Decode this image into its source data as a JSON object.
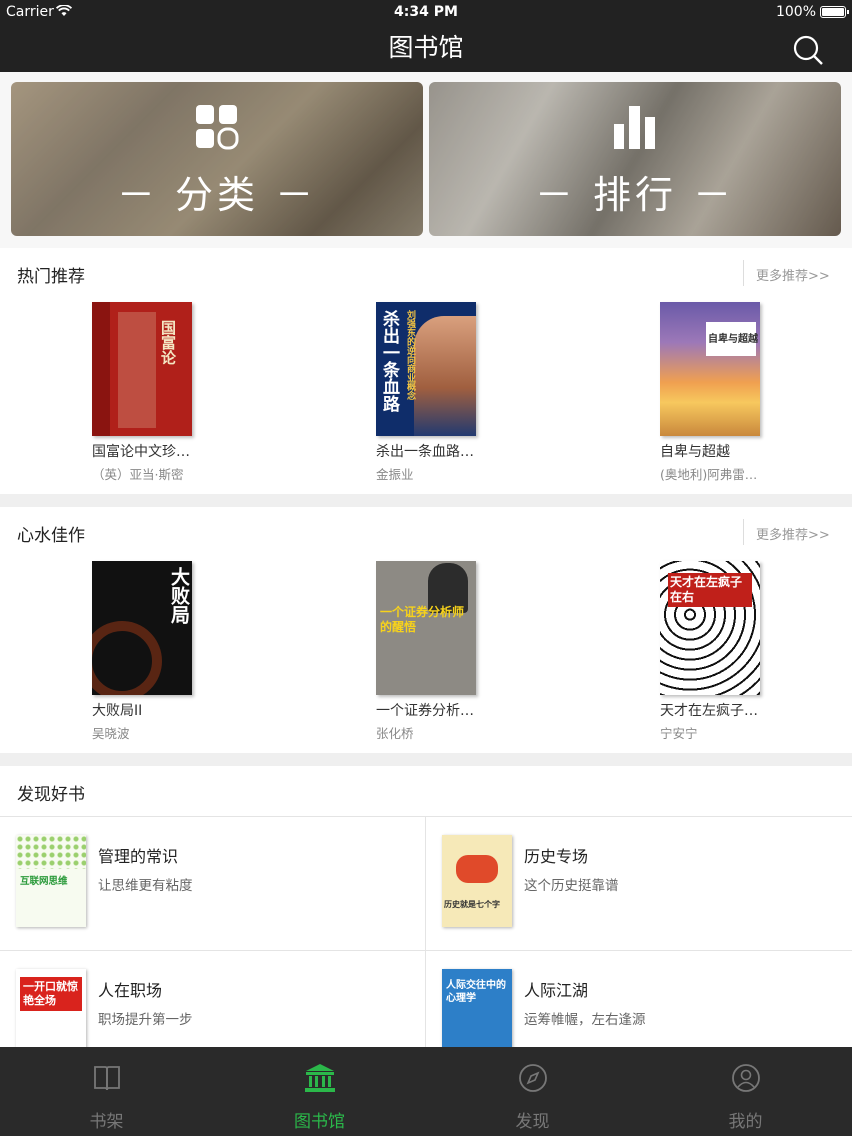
{
  "status_bar": {
    "carrier": "Carrier",
    "time": "4:34 PM",
    "battery": "100%"
  },
  "nav": {
    "title": "图书馆"
  },
  "banners": [
    {
      "label": "－ 分类 －",
      "icon": "grid-icon"
    },
    {
      "label": "－ 排行 －",
      "icon": "bar-chart-icon"
    }
  ],
  "hot": {
    "title": "热门推荐",
    "more": "更多推荐>>",
    "books": [
      {
        "title": "国富论中文珍…",
        "author": "（英）亚当·斯密",
        "cover_text": "国富论"
      },
      {
        "title": "杀出一条血路…",
        "author": "金振业",
        "cover_text": "杀出一条血路",
        "cover_sub": "刘强东的逆向商业概念"
      },
      {
        "title": "自卑与超越",
        "author": "(奥地利)阿弗雷…",
        "cover_text": "自卑与超越"
      }
    ]
  },
  "xinshui": {
    "title": "心水佳作",
    "more": "更多推荐>>",
    "books": [
      {
        "title": "大败局II",
        "author": "吴晓波",
        "cover_text": "大败局"
      },
      {
        "title": "一个证券分析…",
        "author": "张化桥",
        "cover_text": "一个证券分析师的醒悟"
      },
      {
        "title": "天才在左疯子…",
        "author": "宁安宁",
        "cover_text": "天才在左疯子在右"
      }
    ]
  },
  "discover": {
    "title": "发现好书",
    "items": [
      {
        "title": "管理的常识",
        "subtitle": "让思维更有粘度",
        "cover_text": "互联网思维"
      },
      {
        "title": "历史专场",
        "subtitle": "这个历史挺靠谱",
        "cover_text": "历史就是七个字"
      },
      {
        "title": "人在职场",
        "subtitle": "职场提升第一步",
        "cover_text": "一开口就惊艳全场"
      },
      {
        "title": "人际江湖",
        "subtitle": "运筹帷幄，左右逢源",
        "cover_text": "人际交往中的心理学"
      }
    ]
  },
  "tabs": [
    {
      "label": "书架",
      "icon": "book-open-icon",
      "active": false
    },
    {
      "label": "图书馆",
      "icon": "library-icon",
      "active": true
    },
    {
      "label": "发现",
      "icon": "compass-icon",
      "active": false
    },
    {
      "label": "我的",
      "icon": "user-icon",
      "active": false
    }
  ],
  "colors": {
    "header": "#222222",
    "accent": "#2bb84a",
    "tabbar": "#2a2a2a"
  }
}
